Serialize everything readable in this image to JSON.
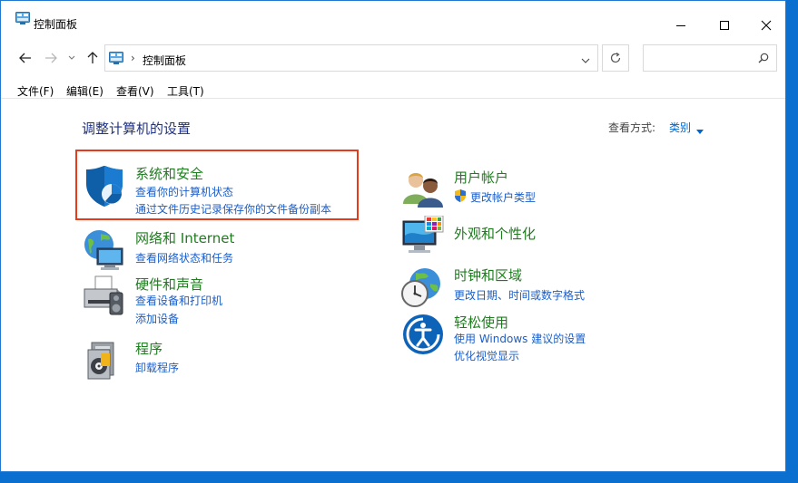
{
  "window": {
    "title": "控制面板"
  },
  "address_bar": {
    "crumb": "控制面板",
    "separator": "›"
  },
  "menu": [
    "文件(F)",
    "编辑(E)",
    "查看(V)",
    "工具(T)"
  ],
  "main": {
    "title": "调整计算机的设置",
    "view_by_label": "查看方式:",
    "view_by_value": "类别"
  },
  "categories": {
    "system_security": {
      "title": "系统和安全",
      "links": [
        "查看你的计算机状态",
        "通过文件历史记录保存你的文件备份副本"
      ]
    },
    "network": {
      "title": "网络和 Internet",
      "links": [
        "查看网络状态和任务"
      ]
    },
    "hardware": {
      "title": "硬件和声音",
      "links": [
        "查看设备和打印机",
        "添加设备"
      ]
    },
    "programs": {
      "title": "程序",
      "links": [
        "卸载程序"
      ]
    },
    "user_accounts": {
      "title": "用户帐户",
      "links": [
        "更改帐户类型"
      ]
    },
    "appearance": {
      "title": "外观和个性化",
      "links": []
    },
    "clock_region": {
      "title": "时钟和区域",
      "links": [
        "更改日期、时间或数字格式"
      ]
    },
    "ease_access": {
      "title": "轻松使用",
      "links": [
        "使用 Windows 建议的设置",
        "优化视觉显示"
      ]
    }
  },
  "colors": {
    "category_title": "#1f7c1f",
    "link": "#1a5ec9",
    "highlight_border": "#e63a1a",
    "page_title": "#1e3287"
  }
}
